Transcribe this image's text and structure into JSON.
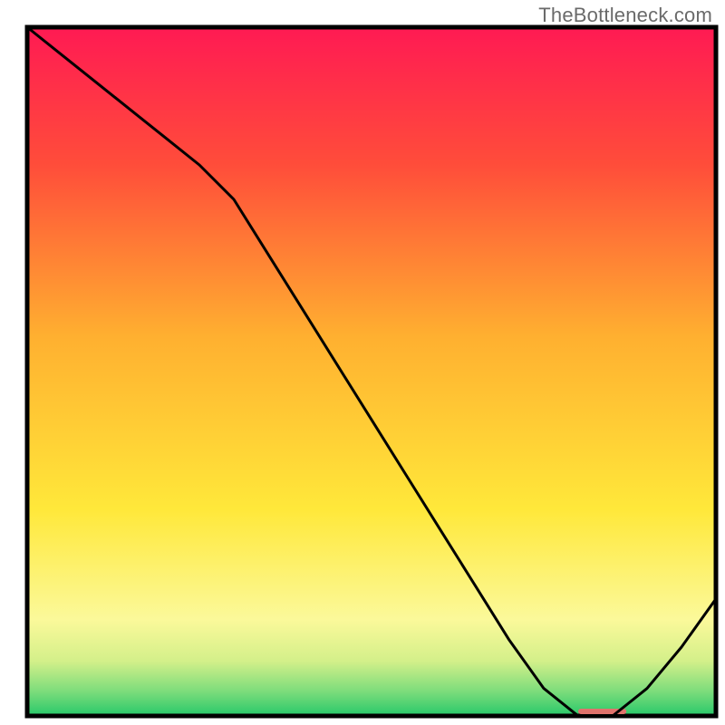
{
  "watermark": "TheBottleneck.com",
  "chart_data": {
    "type": "line",
    "title": "",
    "xlabel": "",
    "ylabel": "",
    "xlim": [
      0,
      100
    ],
    "ylim": [
      0,
      100
    ],
    "x": [
      0,
      5,
      10,
      15,
      20,
      25,
      30,
      35,
      40,
      45,
      50,
      55,
      60,
      65,
      70,
      75,
      80,
      85,
      90,
      95,
      100
    ],
    "y": [
      100,
      96,
      92,
      88,
      84,
      80,
      75,
      67,
      59,
      51,
      43,
      35,
      27,
      19,
      11,
      4,
      0,
      0,
      4,
      10,
      17
    ],
    "minimum_band": {
      "x_start": 80,
      "x_end": 87,
      "y": 0
    },
    "gradient_stops": [
      {
        "offset": 0.0,
        "color": "#ff1a53"
      },
      {
        "offset": 0.2,
        "color": "#ff4d3a"
      },
      {
        "offset": 0.45,
        "color": "#ffb030"
      },
      {
        "offset": 0.7,
        "color": "#ffe83a"
      },
      {
        "offset": 0.86,
        "color": "#fbf99a"
      },
      {
        "offset": 0.92,
        "color": "#d4f08a"
      },
      {
        "offset": 0.965,
        "color": "#7bdc7b"
      },
      {
        "offset": 1.0,
        "color": "#27c86a"
      }
    ],
    "axis_color": "#000000",
    "line_color": "#000000",
    "line_width": 3,
    "minimum_marker_color": "#e0736c"
  }
}
